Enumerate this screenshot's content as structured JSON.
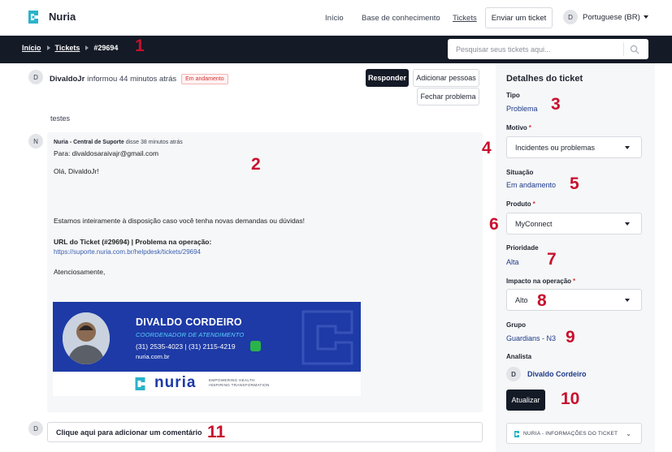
{
  "header": {
    "brand": "Nuria",
    "nav": [
      "Início",
      "Base de conhecimento",
      "Tickets"
    ],
    "new_ticket": "Enviar um ticket",
    "user_initial": "D",
    "language": "Portuguese (BR)"
  },
  "breadcrumb": {
    "home": "Início",
    "tickets": "Tickets",
    "current": "#29694"
  },
  "search": {
    "placeholder": "Pesquisar seus tickets aqui..."
  },
  "ticket": {
    "avatar": "D",
    "author": "DivaldoJr",
    "action": "informou 44 minutos atrás",
    "status": "Em andamento",
    "reply": "Responder",
    "add_people": "Adicionar pessoas",
    "close": "Fechar problema",
    "body": "testes"
  },
  "message": {
    "avatar": "N",
    "author": "Nuria - Central de Suporte",
    "time": "disse 38 minutos atrás",
    "to": "Para: divaldosaraivajr@gmail.com",
    "greeting": "Olá, DivaldoJr!",
    "text": "Estamos inteiramente à disposição caso você tenha novas demandas ou dúvidas!",
    "url_title": "URL do Ticket (#29694) | Problema na operação:",
    "url": "https://suporte.nuria.com.br/helpdesk/tickets/29694",
    "closing": "Atenciosamente,"
  },
  "signature": {
    "name": "DIVALDO CORDEIRO",
    "role": "COORDENADOR DE ATENDIMENTO",
    "phone": "(31) 2535-4023 | (31) 2115-4219",
    "site": "nuria.com.br",
    "brand": "nuria",
    "tagline1": "EMPOWERING HEALTH",
    "tagline2": "INSPIRING TRANSFORMATION"
  },
  "comment": {
    "avatar": "D",
    "placeholder": "Clique aqui para adicionar um comentário"
  },
  "details": {
    "title": "Detalhes do ticket",
    "tipo_label": "Tipo",
    "tipo": "Problema",
    "motivo_label": "Motivo",
    "motivo": "Incidentes ou problemas",
    "situacao_label": "Situação",
    "situacao": "Em andamento",
    "produto_label": "Produto",
    "produto": "MyConnect",
    "prioridade_label": "Prioridade",
    "prioridade": "Alta",
    "impacto_label": "Impacto na operação",
    "impacto": "Alto",
    "grupo_label": "Grupo",
    "grupo": "Guardians - N3",
    "analista_label": "Analista",
    "analista_initial": "D",
    "analista": "Divaldo Cordeiro",
    "required_mark": "*",
    "update": "Atualizar",
    "info_panel": "NURIA - INFORMAÇÕES DO TICKET"
  },
  "annotations": [
    "1",
    "2",
    "3",
    "4",
    "5",
    "6",
    "7",
    "8",
    "9",
    "10",
    "11"
  ],
  "colors": {
    "dark": "#141a26",
    "accent": "#1d3a8a",
    "annotation": "#c8102e",
    "signature_blue": "#1d3aa6"
  }
}
